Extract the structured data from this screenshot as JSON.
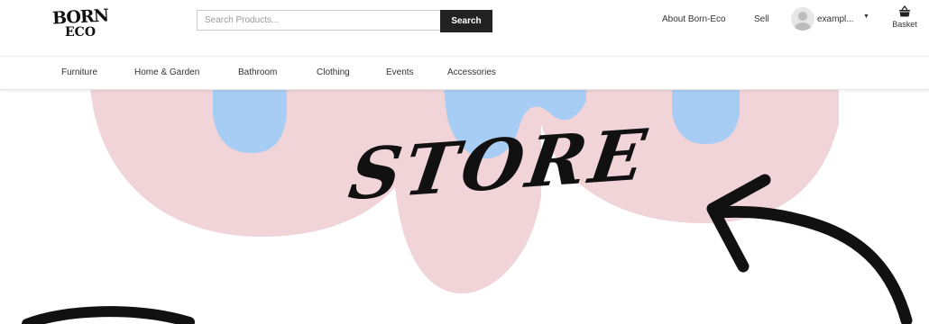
{
  "logo": {
    "line1": "BORN",
    "line2": "ECO"
  },
  "search": {
    "placeholder": "Search Products...",
    "button_label": "Search"
  },
  "header_links": {
    "about": "About Born-Eco",
    "sell": "Sell"
  },
  "user": {
    "name": "exampl...",
    "caret": "▼"
  },
  "basket": {
    "label": "Basket"
  },
  "nav": {
    "items": [
      "Furniture",
      "Home & Garden",
      "Bathroom",
      "Clothing",
      "Events",
      "Accessories"
    ]
  },
  "hero": {
    "title": "STORE"
  },
  "colors": {
    "pink": "#f0d4d8",
    "blue": "#a8cdf5",
    "dark": "#111111"
  }
}
